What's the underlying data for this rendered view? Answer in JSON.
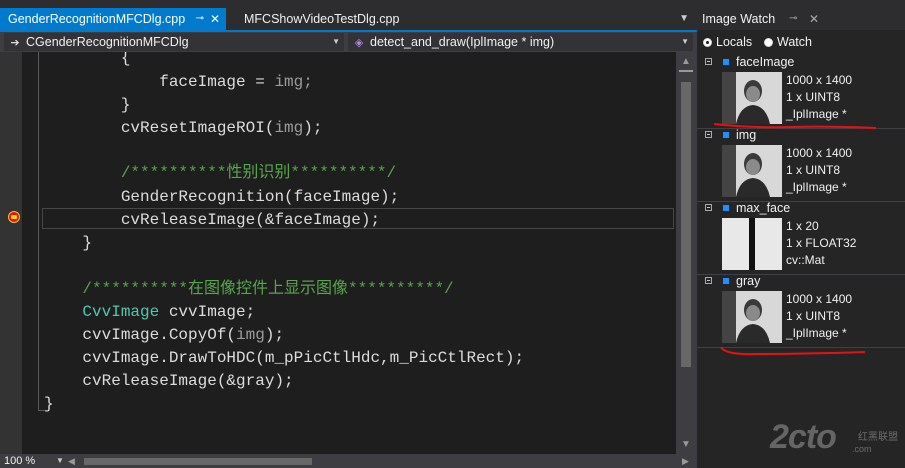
{
  "tabs": {
    "active": "GenderRecognitionMFCDlg.cpp",
    "pin_icon": "pin-icon",
    "close_icon": "close-icon",
    "second": "MFCShowVideoTestDlg.cpp"
  },
  "nav": {
    "class_combo": "CGenderRecognitionMFCDlg",
    "member_combo": "detect_and_draw(IplImage * img)"
  },
  "code": {
    "l1": "{",
    "l2a": "faceImage = ",
    "l2b": "img;",
    "l3": "}",
    "l4a": "cvResetImageROI(",
    "l4b": "img",
    "l4c": ");",
    "l5": "/**********性别识别**********/",
    "l6": "GenderRecognition(faceImage);",
    "l7": "cvReleaseImage(&faceImage);",
    "l8": "}",
    "l9": "/**********在图像控件上显示图像**********/",
    "l10a": "CvvImage",
    "l10b": " cvvImage;",
    "l11a": "cvvImage.CopyOf(",
    "l11b": "img",
    "l11c": ");",
    "l12": "cvvImage.DrawToHDC(m_pPicCtlHdc,m_PicCtlRect);",
    "l13": "cvReleaseImage(&gray);",
    "l14": "}"
  },
  "zoom": "100 %",
  "image_watch": {
    "title": "Image Watch",
    "radio_locals": "Locals",
    "radio_watch": "Watch",
    "selected": "Locals",
    "items": [
      {
        "name": "faceImage",
        "line1": "1000 x 1400",
        "line2": "1 x UINT8",
        "line3": "_IplImage *"
      },
      {
        "name": "img",
        "line1": "1000 x 1400",
        "line2": "1 x UINT8",
        "line3": "_IplImage *"
      },
      {
        "name": "max_face",
        "line1": "1 x 20",
        "line2": "1 x FLOAT32",
        "line3": "cv::Mat"
      },
      {
        "name": "gray",
        "line1": "1000 x 1400",
        "line2": "1 x UINT8",
        "line3": "_IplImage *"
      }
    ]
  },
  "watermark": {
    "logo": "2cto",
    "sub": "红黑联盟",
    "url": ".com"
  },
  "colors": {
    "accent": "#007acc",
    "comment": "#57a64a",
    "type": "#4ec9b0",
    "annotation": "#e81010"
  }
}
